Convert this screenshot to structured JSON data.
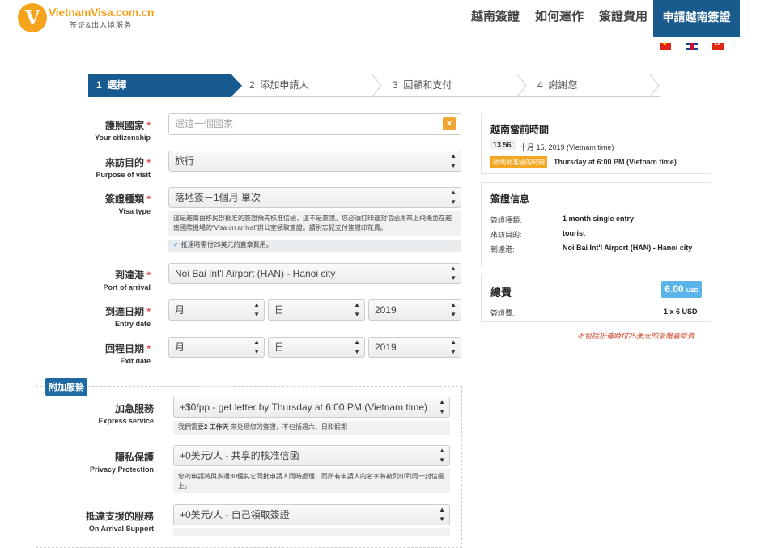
{
  "brand": {
    "name": "VietnamVisa.com.cn",
    "tagline": "签证&出入境服务",
    "logo_letter": "V",
    "color": "#f5a21d"
  },
  "nav": {
    "items": [
      "越南簽證",
      "如何運作",
      "簽證費用"
    ],
    "cta": "申請越南簽證",
    "cta_color": "#1a5b8e"
  },
  "languages": [
    "vietnam-flag-icon",
    "uk-flag-icon",
    "hongkong-flag-icon"
  ],
  "steps": [
    {
      "num": "1",
      "label": "選擇",
      "active": true
    },
    {
      "num": "2",
      "label": "添加申請人",
      "active": false
    },
    {
      "num": "3",
      "label": "回顧和支付",
      "active": false
    },
    {
      "num": "4",
      "label": "謝謝您",
      "active": false
    }
  ],
  "form": {
    "citizenship": {
      "label_zh": "護照國家",
      "label_en": "Your citizenship",
      "placeholder": "選這一個國家",
      "value": ""
    },
    "purpose": {
      "label_zh": "來訪目的",
      "label_en": "Purpose of visit",
      "value": "旅行"
    },
    "visa_type": {
      "label_zh": "簽證種類",
      "label_en": "Visa type",
      "value": "落地簽－1個月 單次",
      "note": "這是越南由移民部批准的簽證預先核准信函，這不是簽證。您必須打印這封信函用來上飛機並在越南國際機場的“Visa on arrival”辦公室領取簽證。請別忘記支付簽證印花費。",
      "stamp_note": "抵達時需付25美元的蓋章費用。"
    },
    "arrival_port": {
      "label_zh": "到達港",
      "label_en": "Port of arrival",
      "value": "Noi Bai Int'l Airport (HAN) - Hanoi city"
    },
    "entry_date": {
      "label_zh": "到達日期",
      "label_en": "Entry date",
      "month": "月",
      "day": "日",
      "year": "2019"
    },
    "exit_date": {
      "label_zh": "回程日期",
      "label_en": "Exit date",
      "month": "月",
      "day": "日",
      "year": "2019"
    },
    "required_mark": "*"
  },
  "extras": {
    "title": "附加服務",
    "express": {
      "label_zh": "加急服務",
      "label_en": "Express service",
      "value": "+$0/pp - get letter by Thursday at 6:00 PM (Vietnam time)",
      "note_pre": "我們需要",
      "note_bold": "2 工作天",
      "note_post": " 來处理您的簽證，不包括週六、日和假期"
    },
    "privacy": {
      "label_zh": "隱私保護",
      "label_en": "Privacy Protection",
      "value": "+0美元/人 - 共享的核准信函",
      "note": "您的申請將與多達30個其它同批申請人同時處理，而所有申請人的名字將被列印到同一封信函上。"
    },
    "arrival_support": {
      "label_zh": "抵達支援的服務",
      "label_en": "On Arrival Support",
      "value": "+0美元/人 - 自己領取簽證"
    }
  },
  "sidebar": {
    "time_card": {
      "title": "越南當前時間",
      "time": "13 56'",
      "date": "十月 15, 2019 (Vietnam time)",
      "badge": "收到批准函的時間",
      "receive_time": "Thursday at 6:00 PM (Vietnam time)"
    },
    "visa_card": {
      "title": "簽證信息",
      "rows": [
        {
          "key": "簽證種類:",
          "value": "1 month single entry"
        },
        {
          "key": "來訪目的:",
          "value": "tourist"
        },
        {
          "key": "到達港:",
          "value": "Noi Bai Int'l Airport (HAN) - Hanoi city"
        }
      ]
    },
    "total_card": {
      "title": "總費",
      "amount": "6.00",
      "currency": "USD",
      "fee_label": "簽證費:",
      "fee_value": "1 x 6 USD"
    },
    "warning": "不包括抵達時付25美元的簽證蓋章費",
    "warning_color": "#d0442b"
  }
}
